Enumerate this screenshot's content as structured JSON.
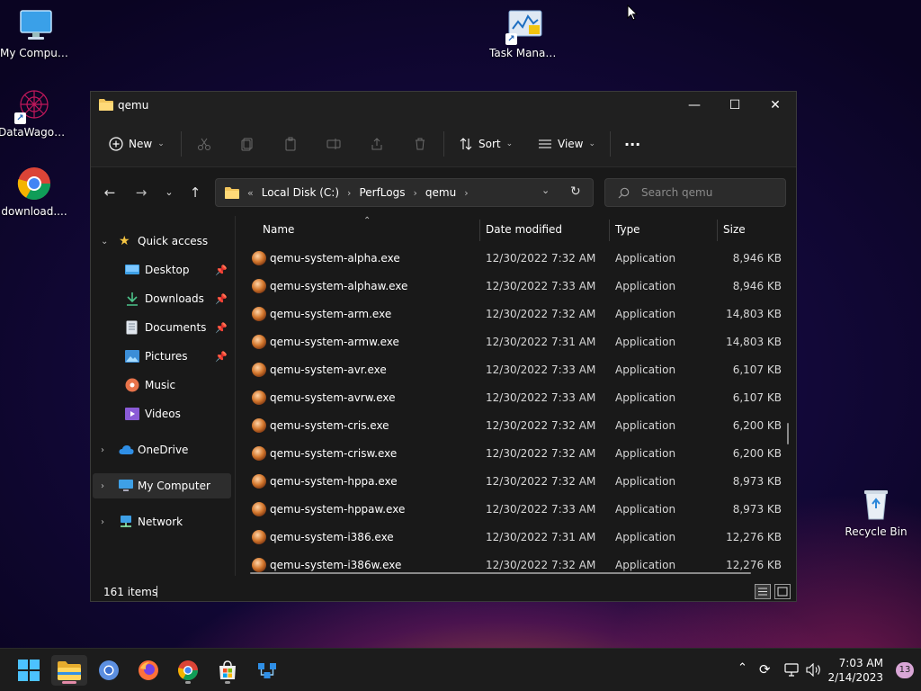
{
  "desktop": {
    "icons": [
      {
        "label": "My Computer"
      },
      {
        "label": "DataWagon..."
      },
      {
        "label": "download...."
      },
      {
        "label": "Task Manager"
      },
      {
        "label": "Recycle Bin"
      }
    ]
  },
  "window": {
    "title": "qemu",
    "controls": {
      "minimize": "—",
      "maximize": "☐",
      "close": "✕"
    }
  },
  "toolbar": {
    "new_label": "New",
    "sort_label": "Sort",
    "view_label": "View",
    "more_label": "···"
  },
  "address": {
    "overflow": "«",
    "crumbs": [
      "Local Disk (C:)",
      "PerfLogs",
      "qemu"
    ]
  },
  "search": {
    "placeholder": "Search qemu"
  },
  "sidebar": {
    "quick_access": "Quick access",
    "items": [
      {
        "label": "Desktop",
        "icon": "desktop-icon",
        "pinned": true
      },
      {
        "label": "Downloads",
        "icon": "download-icon",
        "pinned": true
      },
      {
        "label": "Documents",
        "icon": "document-icon",
        "pinned": true
      },
      {
        "label": "Pictures",
        "icon": "picture-icon",
        "pinned": true
      },
      {
        "label": "Music",
        "icon": "music-icon",
        "pinned": false
      },
      {
        "label": "Videos",
        "icon": "video-icon",
        "pinned": false
      }
    ],
    "onedrive": "OneDrive",
    "my_computer": "My Computer",
    "network": "Network"
  },
  "columns": {
    "name": "Name",
    "date": "Date modified",
    "type": "Type",
    "size": "Size"
  },
  "files": [
    {
      "name": "qemu-system-alpha.exe",
      "date": "12/30/2022 7:32 AM",
      "type": "Application",
      "size": "8,946 KB"
    },
    {
      "name": "qemu-system-alphaw.exe",
      "date": "12/30/2022 7:33 AM",
      "type": "Application",
      "size": "8,946 KB"
    },
    {
      "name": "qemu-system-arm.exe",
      "date": "12/30/2022 7:32 AM",
      "type": "Application",
      "size": "14,803 KB"
    },
    {
      "name": "qemu-system-armw.exe",
      "date": "12/30/2022 7:31 AM",
      "type": "Application",
      "size": "14,803 KB"
    },
    {
      "name": "qemu-system-avr.exe",
      "date": "12/30/2022 7:33 AM",
      "type": "Application",
      "size": "6,107 KB"
    },
    {
      "name": "qemu-system-avrw.exe",
      "date": "12/30/2022 7:33 AM",
      "type": "Application",
      "size": "6,107 KB"
    },
    {
      "name": "qemu-system-cris.exe",
      "date": "12/30/2022 7:32 AM",
      "type": "Application",
      "size": "6,200 KB"
    },
    {
      "name": "qemu-system-crisw.exe",
      "date": "12/30/2022 7:32 AM",
      "type": "Application",
      "size": "6,200 KB"
    },
    {
      "name": "qemu-system-hppa.exe",
      "date": "12/30/2022 7:32 AM",
      "type": "Application",
      "size": "8,973 KB"
    },
    {
      "name": "qemu-system-hppaw.exe",
      "date": "12/30/2022 7:33 AM",
      "type": "Application",
      "size": "8,973 KB"
    },
    {
      "name": "qemu-system-i386.exe",
      "date": "12/30/2022 7:31 AM",
      "type": "Application",
      "size": "12,276 KB"
    },
    {
      "name": "qemu-system-i386w.exe",
      "date": "12/30/2022 7:32 AM",
      "type": "Application",
      "size": "12,276 KB"
    }
  ],
  "status": {
    "item_count": "161 items"
  },
  "taskbar": {
    "time": "7:03 AM",
    "date": "2/14/2023",
    "notifications": "13"
  }
}
